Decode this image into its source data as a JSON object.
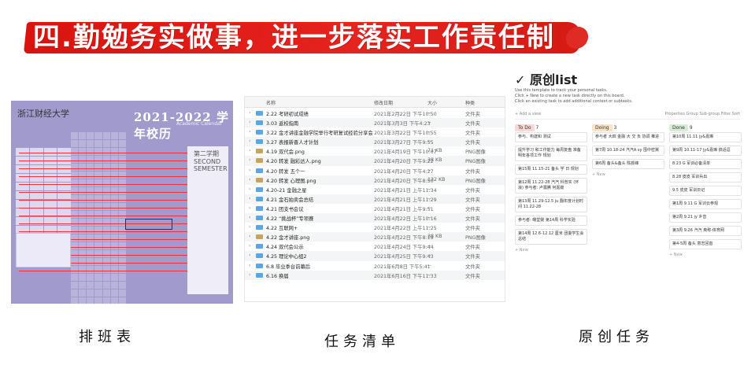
{
  "header": {
    "title": "四.勤勉务实做事，进一步落实工作责任制"
  },
  "colors": {
    "accent_red": "#e02b25",
    "panel_purple": "#a09acd",
    "folder_blue": "#5aa7e8"
  },
  "panels": {
    "schedule": {
      "caption": "排班表",
      "univ": "浙江财经大学",
      "year": "2021-2022 学年校历",
      "year_sub": "Academic Calendar",
      "second_semester": "第二学期 SECOND SEMESTER"
    },
    "tasks": {
      "caption": "任务清单",
      "columns": {
        "name": "名称",
        "date": "修改日期",
        "size": "大小",
        "kind": "种类"
      },
      "files": [
        {
          "name": "2.22 考研初试成绩",
          "date": "2021年2月22日 下午10:50",
          "size": "--",
          "kind": "文件夹",
          "type": "folder"
        },
        {
          "name": "3.03 返校指南",
          "date": "2021年3月3日 下午4:23",
          "size": "--",
          "kind": "文件夹",
          "type": "folder"
        },
        {
          "name": "3.22 金才讲座金融学院举行考研复试经验分享会",
          "date": "2021年3月22日 下午10:55",
          "size": "--",
          "kind": "文件夹",
          "type": "folder"
        },
        {
          "name": "3.27 表报新晋人才计划",
          "date": "2021年3月27日 下午9:55",
          "size": "--",
          "kind": "文件夹",
          "type": "folder"
        },
        {
          "name": "4.19 双代会.png",
          "date": "2021年4月19日 下午10:07",
          "size": "71 KB",
          "kind": "PNG图像",
          "type": "image"
        },
        {
          "name": "4.20 转发 融彩达人.png",
          "date": "2021年4月20日 下午9:22",
          "size": "38 KB",
          "kind": "PNG图像",
          "type": "image"
        },
        {
          "name": "4.20 转发 五个一",
          "date": "2021年4月20日 下午4:27",
          "size": "--",
          "kind": "文件夹",
          "type": "folder"
        },
        {
          "name": "4.20 转发 心理图.png",
          "date": "2021年4月20日 下午8:50",
          "size": "132 KB",
          "kind": "PNG图像",
          "type": "image"
        },
        {
          "name": "4.20-21 金融之星",
          "date": "2021年4月21日 上午11:34",
          "size": "--",
          "kind": "文件夹",
          "type": "folder"
        },
        {
          "name": "4.21 金石拍卖会总结",
          "date": "2021年4月21日 上午11:29",
          "size": "--",
          "kind": "文件夹",
          "type": "folder"
        },
        {
          "name": "4.21 团支书会议",
          "date": "2021年4月21日 上午9:51",
          "size": "--",
          "kind": "文件夹",
          "type": "folder"
        },
        {
          "name": "4.22 “挑战杯”专项赛",
          "date": "2021年4月22日 上午10:16",
          "size": "--",
          "kind": "文件夹",
          "type": "folder"
        },
        {
          "name": "4.22 互联网+",
          "date": "2021年4月22日 上午11:25",
          "size": "--",
          "kind": "文件夹",
          "type": "folder"
        },
        {
          "name": "4.22 金才讲座.png",
          "date": "2021年4月22日 下午8:19",
          "size": "38 KB",
          "kind": "PNG图像",
          "type": "image"
        },
        {
          "name": "4.24 双代会公示",
          "date": "2021年4月24日 下午9:44",
          "size": "--",
          "kind": "文件夹",
          "type": "folder"
        },
        {
          "name": "4.25 理论中心组2",
          "date": "2021年4月25日 下午9:43",
          "size": "--",
          "kind": "文件夹",
          "type": "folder"
        },
        {
          "name": "6.8 毕业季台前幕后",
          "date": "2021年6月8日 下午5:41",
          "size": "--",
          "kind": "文件夹",
          "type": "folder"
        },
        {
          "name": "6.16 换届",
          "date": "2021年6月16日 下午11:33",
          "size": "--",
          "kind": "文件夹",
          "type": "folder"
        }
      ]
    },
    "original": {
      "caption": "原创任务",
      "title": "✓ 原创list",
      "desc1": "Use this template to track your personal tasks.",
      "desc2": "Click + New to create a new task directly on this board.",
      "desc3": "Click an existing task to add additional context or subtasks.",
      "add_view": "+ Add a view",
      "toolbar_right": "Properties  Group  Sub-group  Filter  Sort",
      "columns": [
        {
          "label": "To Do",
          "color": "#f6d9d6",
          "count": "7",
          "cards": [
            "参与、构建和 测试",
            "提升学习 和工作能力 每周复盘 准备明年各项工作 规划",
            "第15周 11.15-21 备头 学 日 规划",
            "第12周 11.22-28 汽汽 科普实 (环浪) 参与者: 卢露腾 何嘉媛",
            "第13周 11.29-12.5 ju 翻年度计划时间 11.22-28",
            "参与者: 曙堂媛 第14周 科学实验",
            "第14周 12.6-12.12 厘米 团委学生会总结"
          ]
        },
        {
          "label": "Doing",
          "color": "#f7e3c6",
          "count": "3",
          "cards": [
            "参与者 大四 金融 大 交 负 协调 推进",
            "第7周 10.18-24 汽汽A sy 围中密冀",
            "第6周 备头&备头 陈颜峰"
          ]
        },
        {
          "label": "Done",
          "color": "#d9ecd6",
          "count": "9",
          "cards": [
            "第10周 11.11 jy&嘉琳",
            "第9周 10.11-17 jy&嘉琳 搞话逗",
            "8.23 G 军训必备清单",
            "8.28 皮皮 军训兵出",
            "9.5 皮皮 军训日记",
            "第1周 9.11 G 军训云参观",
            "第2周 9.21 jy 乡音",
            "第3周 9.26 汽汽 奥称-体育网",
            "第4-5周 备头 意志回首"
          ]
        }
      ],
      "new_label": "+ New"
    }
  }
}
